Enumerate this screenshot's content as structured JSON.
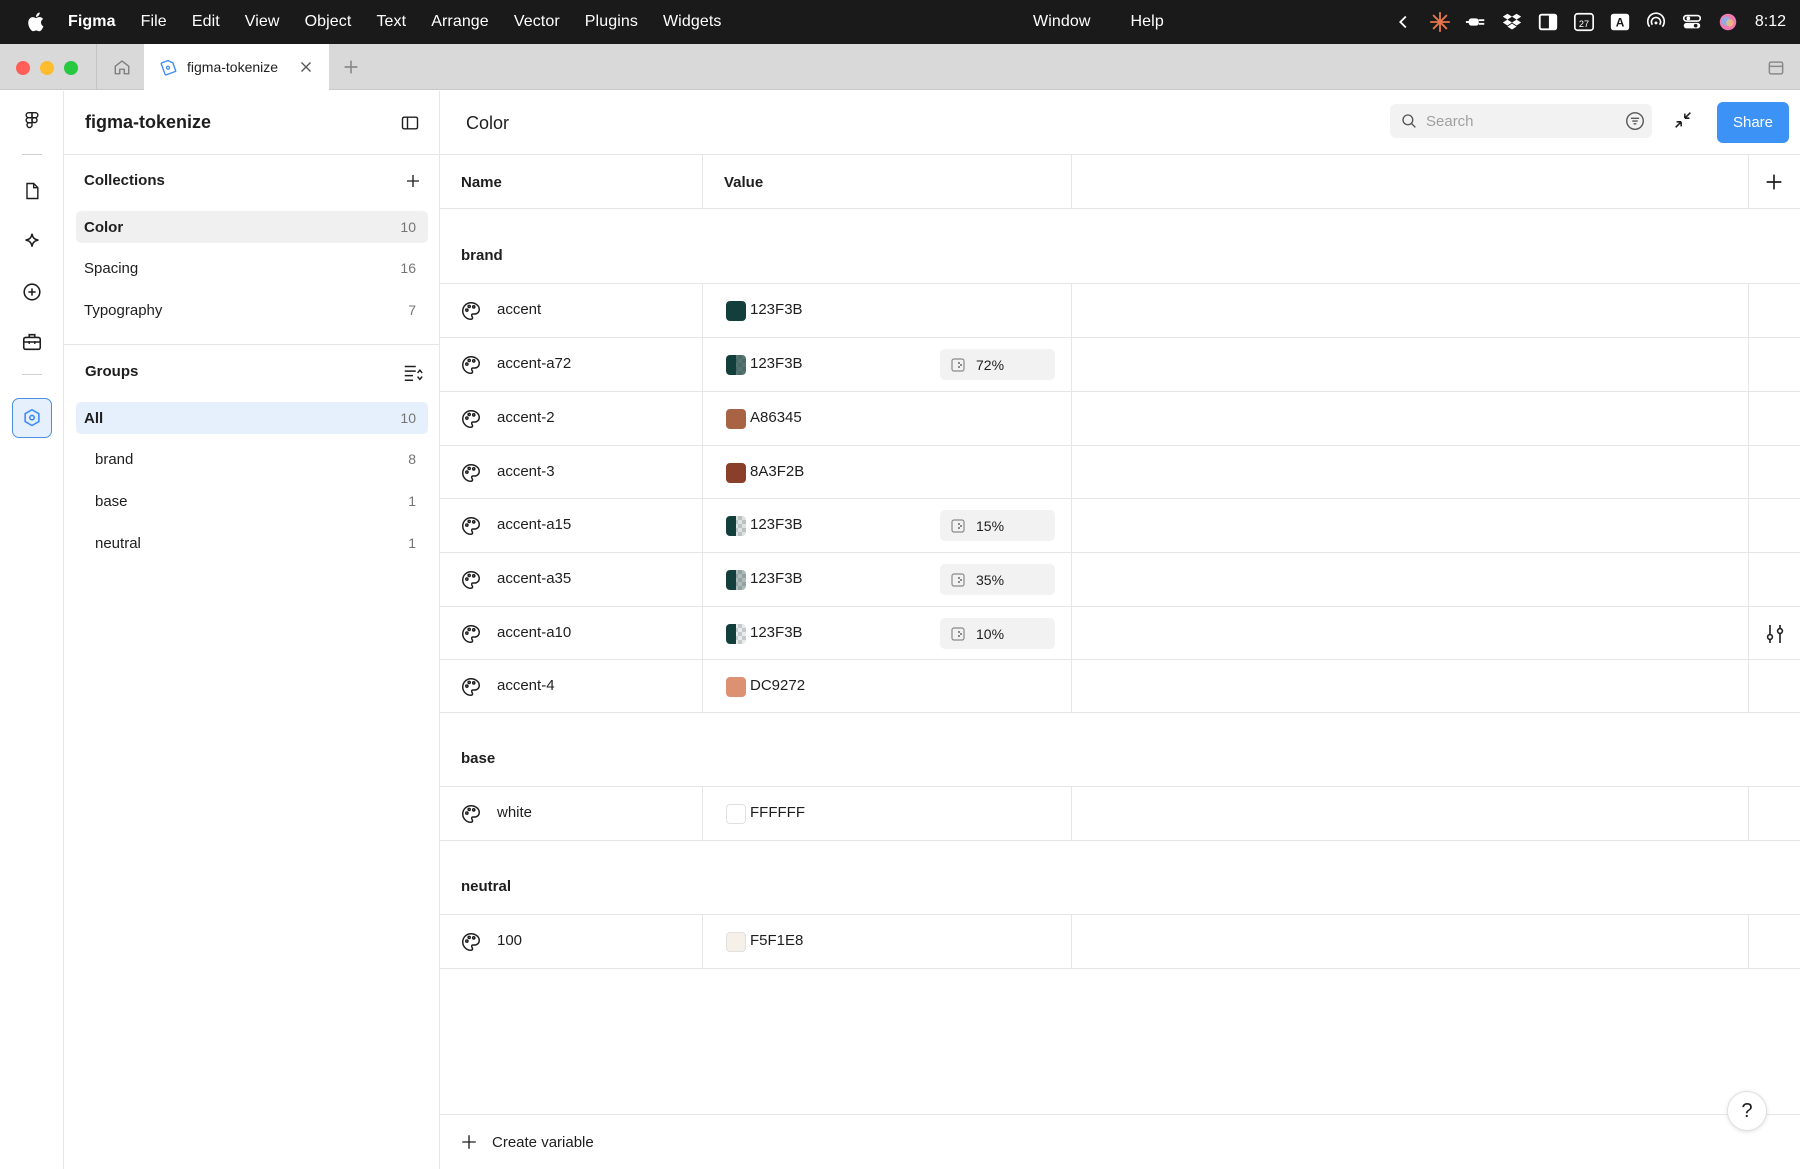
{
  "menubar": {
    "app_name": "Figma",
    "items": [
      "File",
      "Edit",
      "View",
      "Object",
      "Text",
      "Arrange",
      "Vector",
      "Plugins",
      "Widgets"
    ],
    "center_items": [
      "Window",
      "Help"
    ],
    "keyboard_badge": "A",
    "calendar_day": "27",
    "clock": "8:12"
  },
  "tabs": {
    "file_tab_label": "figma-tokenize"
  },
  "sidebar": {
    "title": "figma-tokenize",
    "collections_title": "Collections",
    "collections": [
      {
        "label": "Color",
        "count": "10"
      },
      {
        "label": "Spacing",
        "count": "16"
      },
      {
        "label": "Typography",
        "count": "7"
      }
    ],
    "groups_title": "Groups",
    "groups": [
      {
        "label": "All",
        "count": "10"
      },
      {
        "label": "brand",
        "count": "8"
      },
      {
        "label": "base",
        "count": "1"
      },
      {
        "label": "neutral",
        "count": "1"
      }
    ]
  },
  "main": {
    "title": "Color",
    "search_placeholder": "Search",
    "share_label": "Share",
    "columns": {
      "name": "Name",
      "value": "Value"
    },
    "groups": [
      {
        "label": "brand",
        "rows": [
          {
            "name": "accent",
            "hex": "123F3B",
            "color": "#123F3B",
            "alpha": null
          },
          {
            "name": "accent-a72",
            "hex": "123F3B",
            "color": "#123F3B",
            "alpha": "72%"
          },
          {
            "name": "accent-2",
            "hex": "A86345",
            "color": "#A86345",
            "alpha": null
          },
          {
            "name": "accent-3",
            "hex": "8A3F2B",
            "color": "#8A3F2B",
            "alpha": null
          },
          {
            "name": "accent-a15",
            "hex": "123F3B",
            "color": "#123F3B",
            "alpha": "15%"
          },
          {
            "name": "accent-a35",
            "hex": "123F3B",
            "color": "#123F3B",
            "alpha": "35%"
          },
          {
            "name": "accent-a10",
            "hex": "123F3B",
            "color": "#123F3B",
            "alpha": "10%"
          },
          {
            "name": "accent-4",
            "hex": "DC9272",
            "color": "#DC9272",
            "alpha": null
          }
        ]
      },
      {
        "label": "base",
        "rows": [
          {
            "name": "white",
            "hex": "FFFFFF",
            "color": "#FFFFFF",
            "alpha": null
          }
        ]
      },
      {
        "label": "neutral",
        "rows": [
          {
            "name": "100",
            "hex": "F5F1E8",
            "color": "#F5F1E8",
            "alpha": null
          }
        ]
      }
    ],
    "create_variable_label": "Create variable",
    "help_label": "?"
  },
  "colors": {
    "accent_blue": "#3D92F5",
    "selected_blue_bg": "#E5F0FC",
    "menubar_bg": "#1A1A1A"
  }
}
